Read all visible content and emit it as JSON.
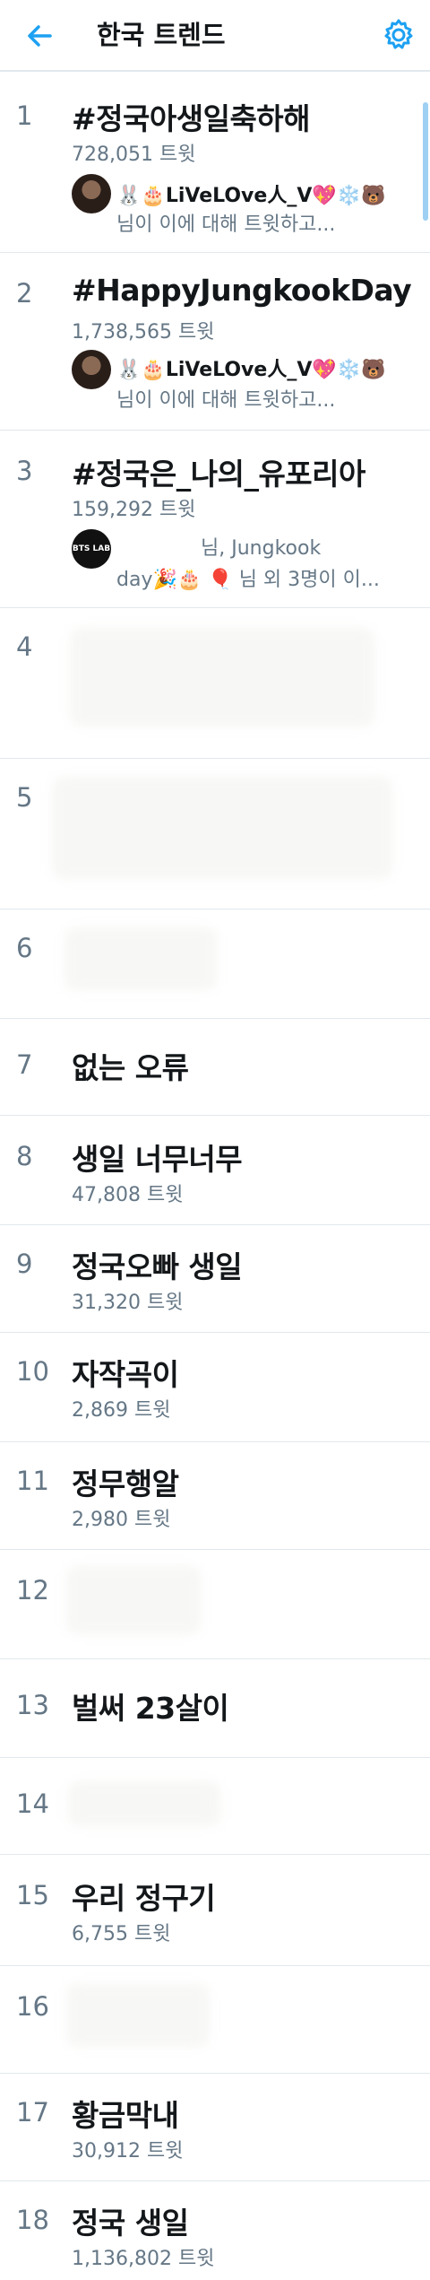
{
  "header": {
    "title": "한국 트렌드",
    "back_icon": "arrow-left-icon",
    "settings_icon": "gear-icon",
    "accent_color": "#1da1f2"
  },
  "trends": [
    {
      "rank": "1",
      "topic": "#정국아생일축하해",
      "count": "728,051 트윗",
      "context_user": "LiVeLOve人_V",
      "context_text": "님이 이에 대해 트윗하고..."
    },
    {
      "rank": "2",
      "topic": "#HappyJungkookDay",
      "count": "1,738,565 트윗",
      "context_user": "LiVeLOve人_V",
      "context_text": "님이 이에 대해 트윗하고..."
    },
    {
      "rank": "3",
      "topic": "#정국은_나의_유포리아",
      "count": "159,292 트윗",
      "context_line1": "님, Jungkook",
      "context_day": "day",
      "context_line2_rest": "님 외 3명이 이...",
      "avatar_text": "BTS LAB"
    },
    {
      "rank": "4"
    },
    {
      "rank": "5"
    },
    {
      "rank": "6"
    },
    {
      "rank": "7",
      "topic": "없는 오류"
    },
    {
      "rank": "8",
      "topic": "생일 너무너무",
      "count": "47,808 트윗"
    },
    {
      "rank": "9",
      "topic": "정국오빠 생일",
      "count": "31,320 트윗"
    },
    {
      "rank": "10",
      "topic": "자작곡이",
      "count": "2,869 트윗"
    },
    {
      "rank": "11",
      "topic": "정무행알",
      "count": "2,980 트윗"
    },
    {
      "rank": "12"
    },
    {
      "rank": "13",
      "topic": "벌써 23살이"
    },
    {
      "rank": "14"
    },
    {
      "rank": "15",
      "topic": "우리 정구기",
      "count": "6,755 트윗"
    },
    {
      "rank": "16"
    },
    {
      "rank": "17",
      "topic": "황금막내",
      "count": "30,912 트윗"
    },
    {
      "rank": "18",
      "topic": "정국 생일",
      "count": "1,136,802 트윗"
    }
  ]
}
